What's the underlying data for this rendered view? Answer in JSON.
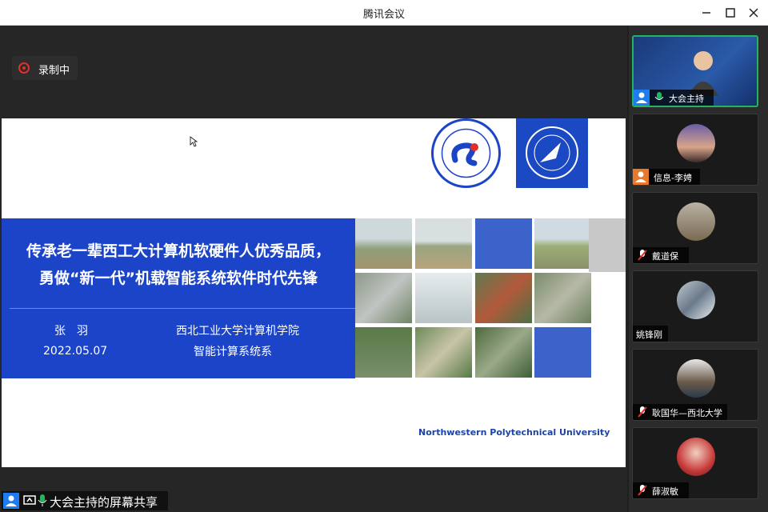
{
  "window": {
    "title": "腾讯会议"
  },
  "recording": {
    "label": "录制中"
  },
  "slide": {
    "title_line1": "传承老一辈西工大计算机软硬件人优秀品质，",
    "title_line2": "勇做“新一代”机载智能系统软件时代先锋",
    "presenter": "张　羽",
    "date": "2022.05.07",
    "school": "西北工业大学计算机学院",
    "department": "智能计算系统系",
    "university_en": "Northwestern Polytechnical University"
  },
  "share_bar": {
    "label": "大会主持的屏幕共享"
  },
  "participants": [
    {
      "name": "大会主持",
      "mic": "on",
      "host": true
    },
    {
      "name": "信息-李娉",
      "mic": "none",
      "host": true
    },
    {
      "name": "戴道保",
      "mic": "muted",
      "host": false
    },
    {
      "name": "姚锋刚",
      "mic": "none",
      "host": false
    },
    {
      "name": "耿国华—西北大学",
      "mic": "muted",
      "host": false
    },
    {
      "name": "薛淑敏",
      "mic": "muted",
      "host": false
    }
  ],
  "colors": {
    "banner": "#1c44c8",
    "active_border": "#22b45e",
    "host_badge": "#1e7cf0",
    "mic_on": "#22b45e",
    "mic_muted": "#e0302a"
  }
}
